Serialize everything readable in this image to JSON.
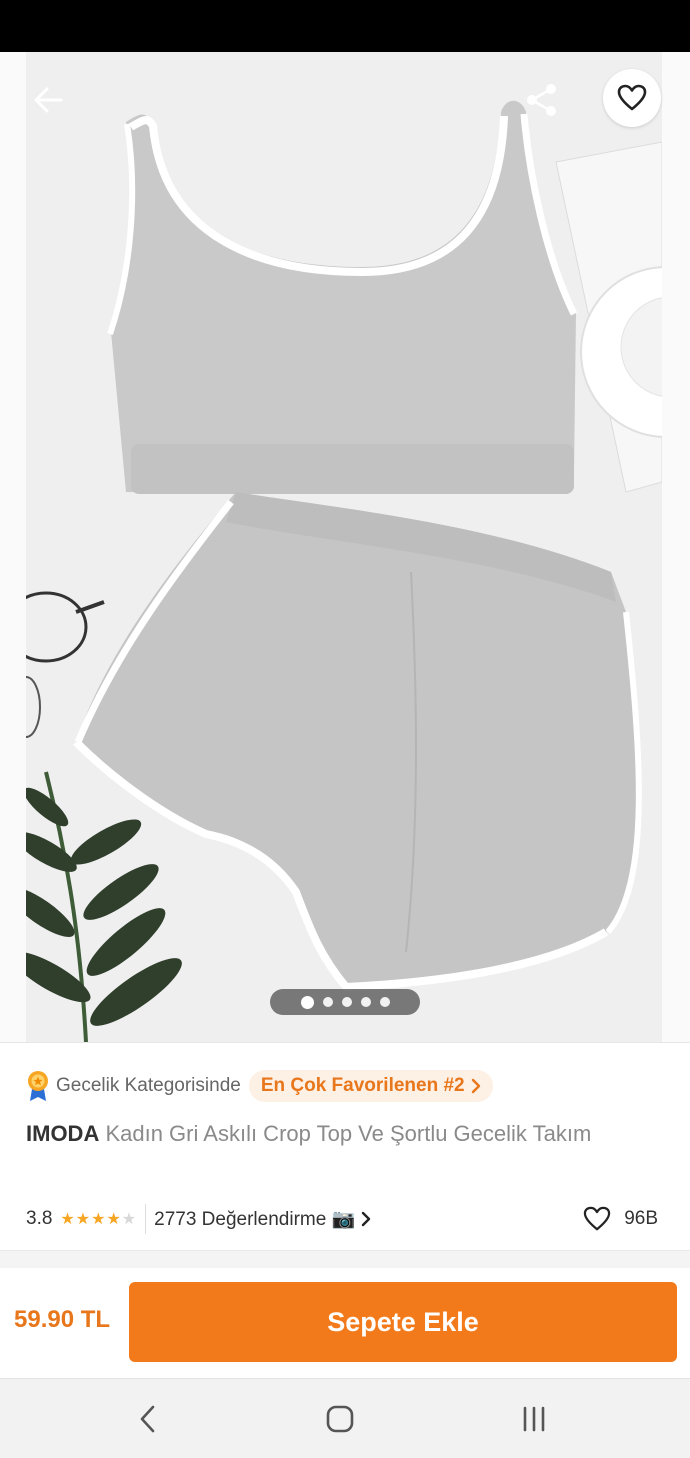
{
  "gallery": {
    "total_images": 5,
    "active_index": 0
  },
  "category": {
    "label": "Gecelik Kategorisinde",
    "badge": "En Çok Favorilenen #2"
  },
  "product": {
    "brand": "IMODA",
    "name": "Kadın Gri Askılı Crop Top Ve Şortlu Gecelik Takım"
  },
  "rating": {
    "score": "3.8",
    "stars_filled": 4,
    "stars_total": 5,
    "reviews_label": "2773 Değerlendirme 📷",
    "likes": "96B"
  },
  "buy": {
    "price": "59.90 TL",
    "button_label": "Sepete Ekle"
  },
  "colors": {
    "accent": "#f27a1a",
    "accent_text": "#e8761b",
    "star": "#f6a623"
  }
}
